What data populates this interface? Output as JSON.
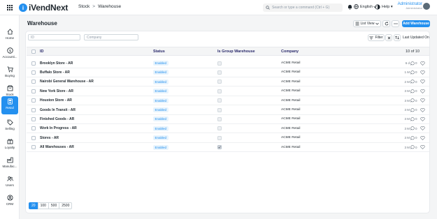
{
  "app": {
    "logo_letter": "i",
    "logo_text": "iVendNext"
  },
  "breadcrumb": [
    "Stock",
    "Warehouse"
  ],
  "search": {
    "placeholder": "Search or type a command (Ctrl + G)"
  },
  "language": "English",
  "help": "Help",
  "user": {
    "name": "Administrator",
    "role": "Administrator"
  },
  "sidebar": [
    {
      "label": "Home",
      "icon": "home-icon"
    },
    {
      "label": "Accounti...",
      "icon": "dollar-icon"
    },
    {
      "label": "Buying",
      "icon": "cart-icon"
    },
    {
      "label": "Stock",
      "icon": "box-icon"
    },
    {
      "label": "Retail",
      "icon": "pos-icon"
    },
    {
      "label": "Selling",
      "icon": "tag-icon"
    },
    {
      "label": "Loyalty",
      "icon": "gift-icon"
    },
    {
      "label": "Manufac...",
      "icon": "factory-icon"
    },
    {
      "label": "Users",
      "icon": "users-icon"
    },
    {
      "label": "CRM",
      "icon": "crm-icon"
    }
  ],
  "page": {
    "title": "Warehouse",
    "list_view": "List View",
    "add_label": "Add Warehouse"
  },
  "filters": {
    "id_placeholder": "ID",
    "company_placeholder": "Company",
    "filter_label": "Filter",
    "sort_label": "Last Updated On"
  },
  "table": {
    "columns": [
      "ID",
      "Status",
      "Is Group Warehouse",
      "Company"
    ],
    "count": "10 of 10",
    "rows": [
      {
        "id": "Brooklyn Store - AR",
        "status": "Enabled",
        "group": false,
        "company": "ACME Retail",
        "time": "6 d",
        "comments": "0"
      },
      {
        "id": "Buffalo Store - AR",
        "status": "Enabled",
        "group": false,
        "company": "ACME Retail",
        "time": "1 M",
        "comments": "0"
      },
      {
        "id": "Nairobi General Warehouse - AR",
        "status": "Enabled",
        "group": false,
        "company": "ACME Retail",
        "time": "2 M",
        "comments": "0"
      },
      {
        "id": "New York Store - AR",
        "status": "Enabled",
        "group": false,
        "company": "ACME Retail",
        "time": "3 M",
        "comments": "0"
      },
      {
        "id": "Houston Store - AR",
        "status": "Enabled",
        "group": false,
        "company": "ACME Retail",
        "time": "3 M",
        "comments": "0"
      },
      {
        "id": "Goods In Transit - AR",
        "status": "Enabled",
        "group": false,
        "company": "ACME Retail",
        "time": "3 M",
        "comments": "0"
      },
      {
        "id": "Finished Goods - AR",
        "status": "Enabled",
        "group": false,
        "company": "ACME Retail",
        "time": "3 M",
        "comments": "0"
      },
      {
        "id": "Work In Progress - AR",
        "status": "Enabled",
        "group": false,
        "company": "ACME Retail",
        "time": "3 M",
        "comments": "0"
      },
      {
        "id": "Stores - AR",
        "status": "Enabled",
        "group": false,
        "company": "ACME Retail",
        "time": "3 M",
        "comments": "0"
      },
      {
        "id": "All Warehouses - AR",
        "status": "Enabled",
        "group": true,
        "company": "ACME Retail",
        "time": "3 M",
        "comments": "0"
      }
    ]
  },
  "pagination": {
    "sizes": [
      "20",
      "100",
      "500",
      "2500"
    ],
    "selected": "20"
  },
  "colors": {
    "accent": "#2490ef",
    "status_bg": "#e8f4fd"
  }
}
